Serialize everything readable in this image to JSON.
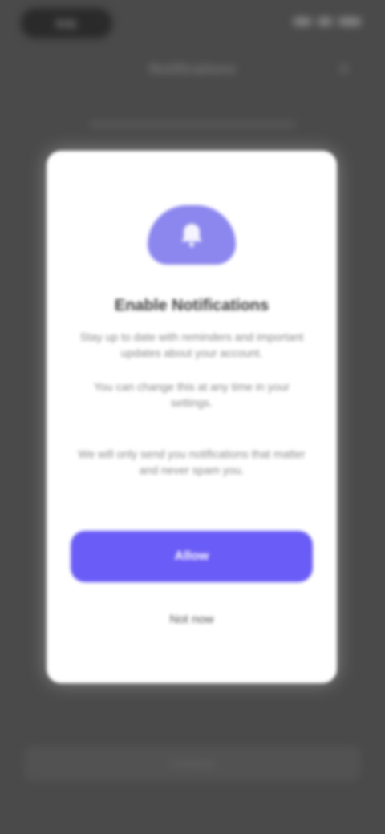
{
  "status_bar": {
    "time": "9:41",
    "icons": [
      "signal-icon",
      "wifi-icon",
      "battery-icon"
    ]
  },
  "background": {
    "title": "Notifications",
    "close_glyph": "✕",
    "footer_label": "Continue"
  },
  "modal": {
    "hero_icon": "bell-icon",
    "title": "Enable Notifications",
    "paragraphs": [
      "Stay up to date with reminders and important updates about your account.",
      "You can change this at any time in your settings.",
      "We will only send you notifications that matter and never spam you."
    ],
    "primary_label": "Allow",
    "secondary_label": "Not now"
  },
  "colors": {
    "overlay": "#4a4a4a",
    "accent": "#6a5cf6",
    "hero": "#8c87ee",
    "surface": "#ffffff"
  }
}
